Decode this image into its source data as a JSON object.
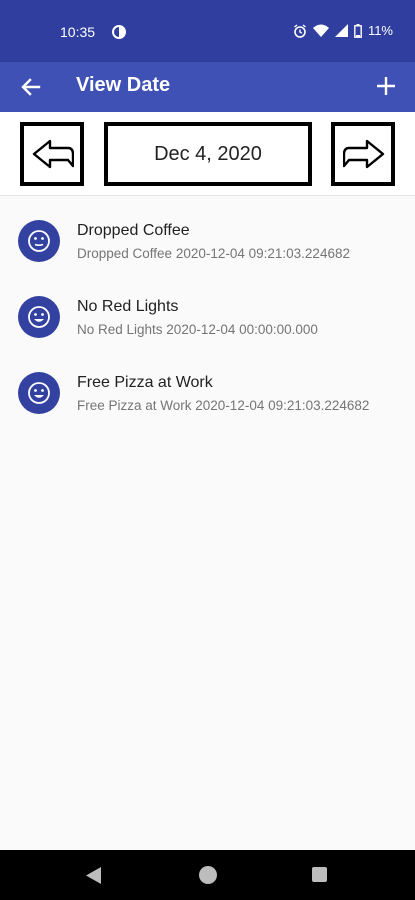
{
  "status_bar": {
    "time": "10:35",
    "battery": "11%",
    "icons": [
      "data-saver-icon",
      "alarm-icon",
      "wifi-icon",
      "signal-icon",
      "battery-icon"
    ]
  },
  "app_bar": {
    "title": "View Date",
    "back_icon": "arrow-left-icon",
    "add_icon": "plus-icon"
  },
  "date_nav": {
    "date": "Dec 4, 2020",
    "prev_icon": "arrow-left-outline-icon",
    "next_icon": "arrow-right-outline-icon"
  },
  "entries": [
    {
      "title": "Dropped Coffee",
      "subtitle": "Dropped Coffee 2020-12-04 09:21:03.224682",
      "icon": "neutral-face-icon"
    },
    {
      "title": "No Red Lights",
      "subtitle": "No Red Lights 2020-12-04 00:00:00.000",
      "icon": "smile-face-icon"
    },
    {
      "title": "Free Pizza at Work",
      "subtitle": "Free Pizza at Work 2020-12-04 09:21:03.224682",
      "icon": "smile-face-icon"
    }
  ],
  "colors": {
    "status_bar": "#303f9f",
    "app_bar": "#3f51b5",
    "avatar": "#3342a0"
  }
}
